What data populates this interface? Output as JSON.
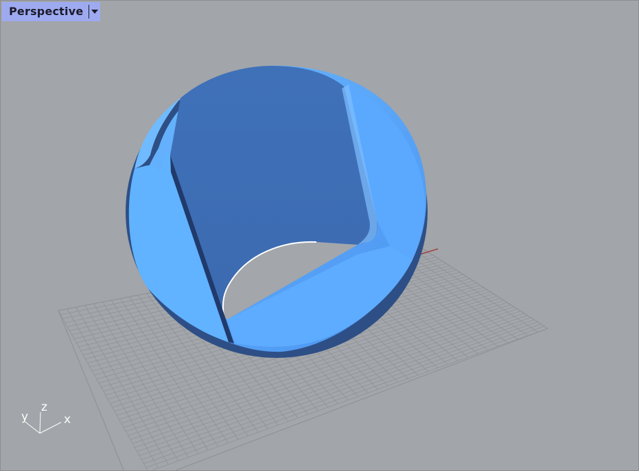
{
  "viewport": {
    "name": "Perspective",
    "dropdown_icon": "chevron-down-icon",
    "background_color": "#a2a5a9",
    "tab_color": "#9eaaf0"
  },
  "axis_widget": {
    "x_label": "x",
    "y_label": "y",
    "z_label": "z"
  },
  "model": {
    "surface_color": "#5aa9ff",
    "shadow_color": "#3f70b8"
  }
}
